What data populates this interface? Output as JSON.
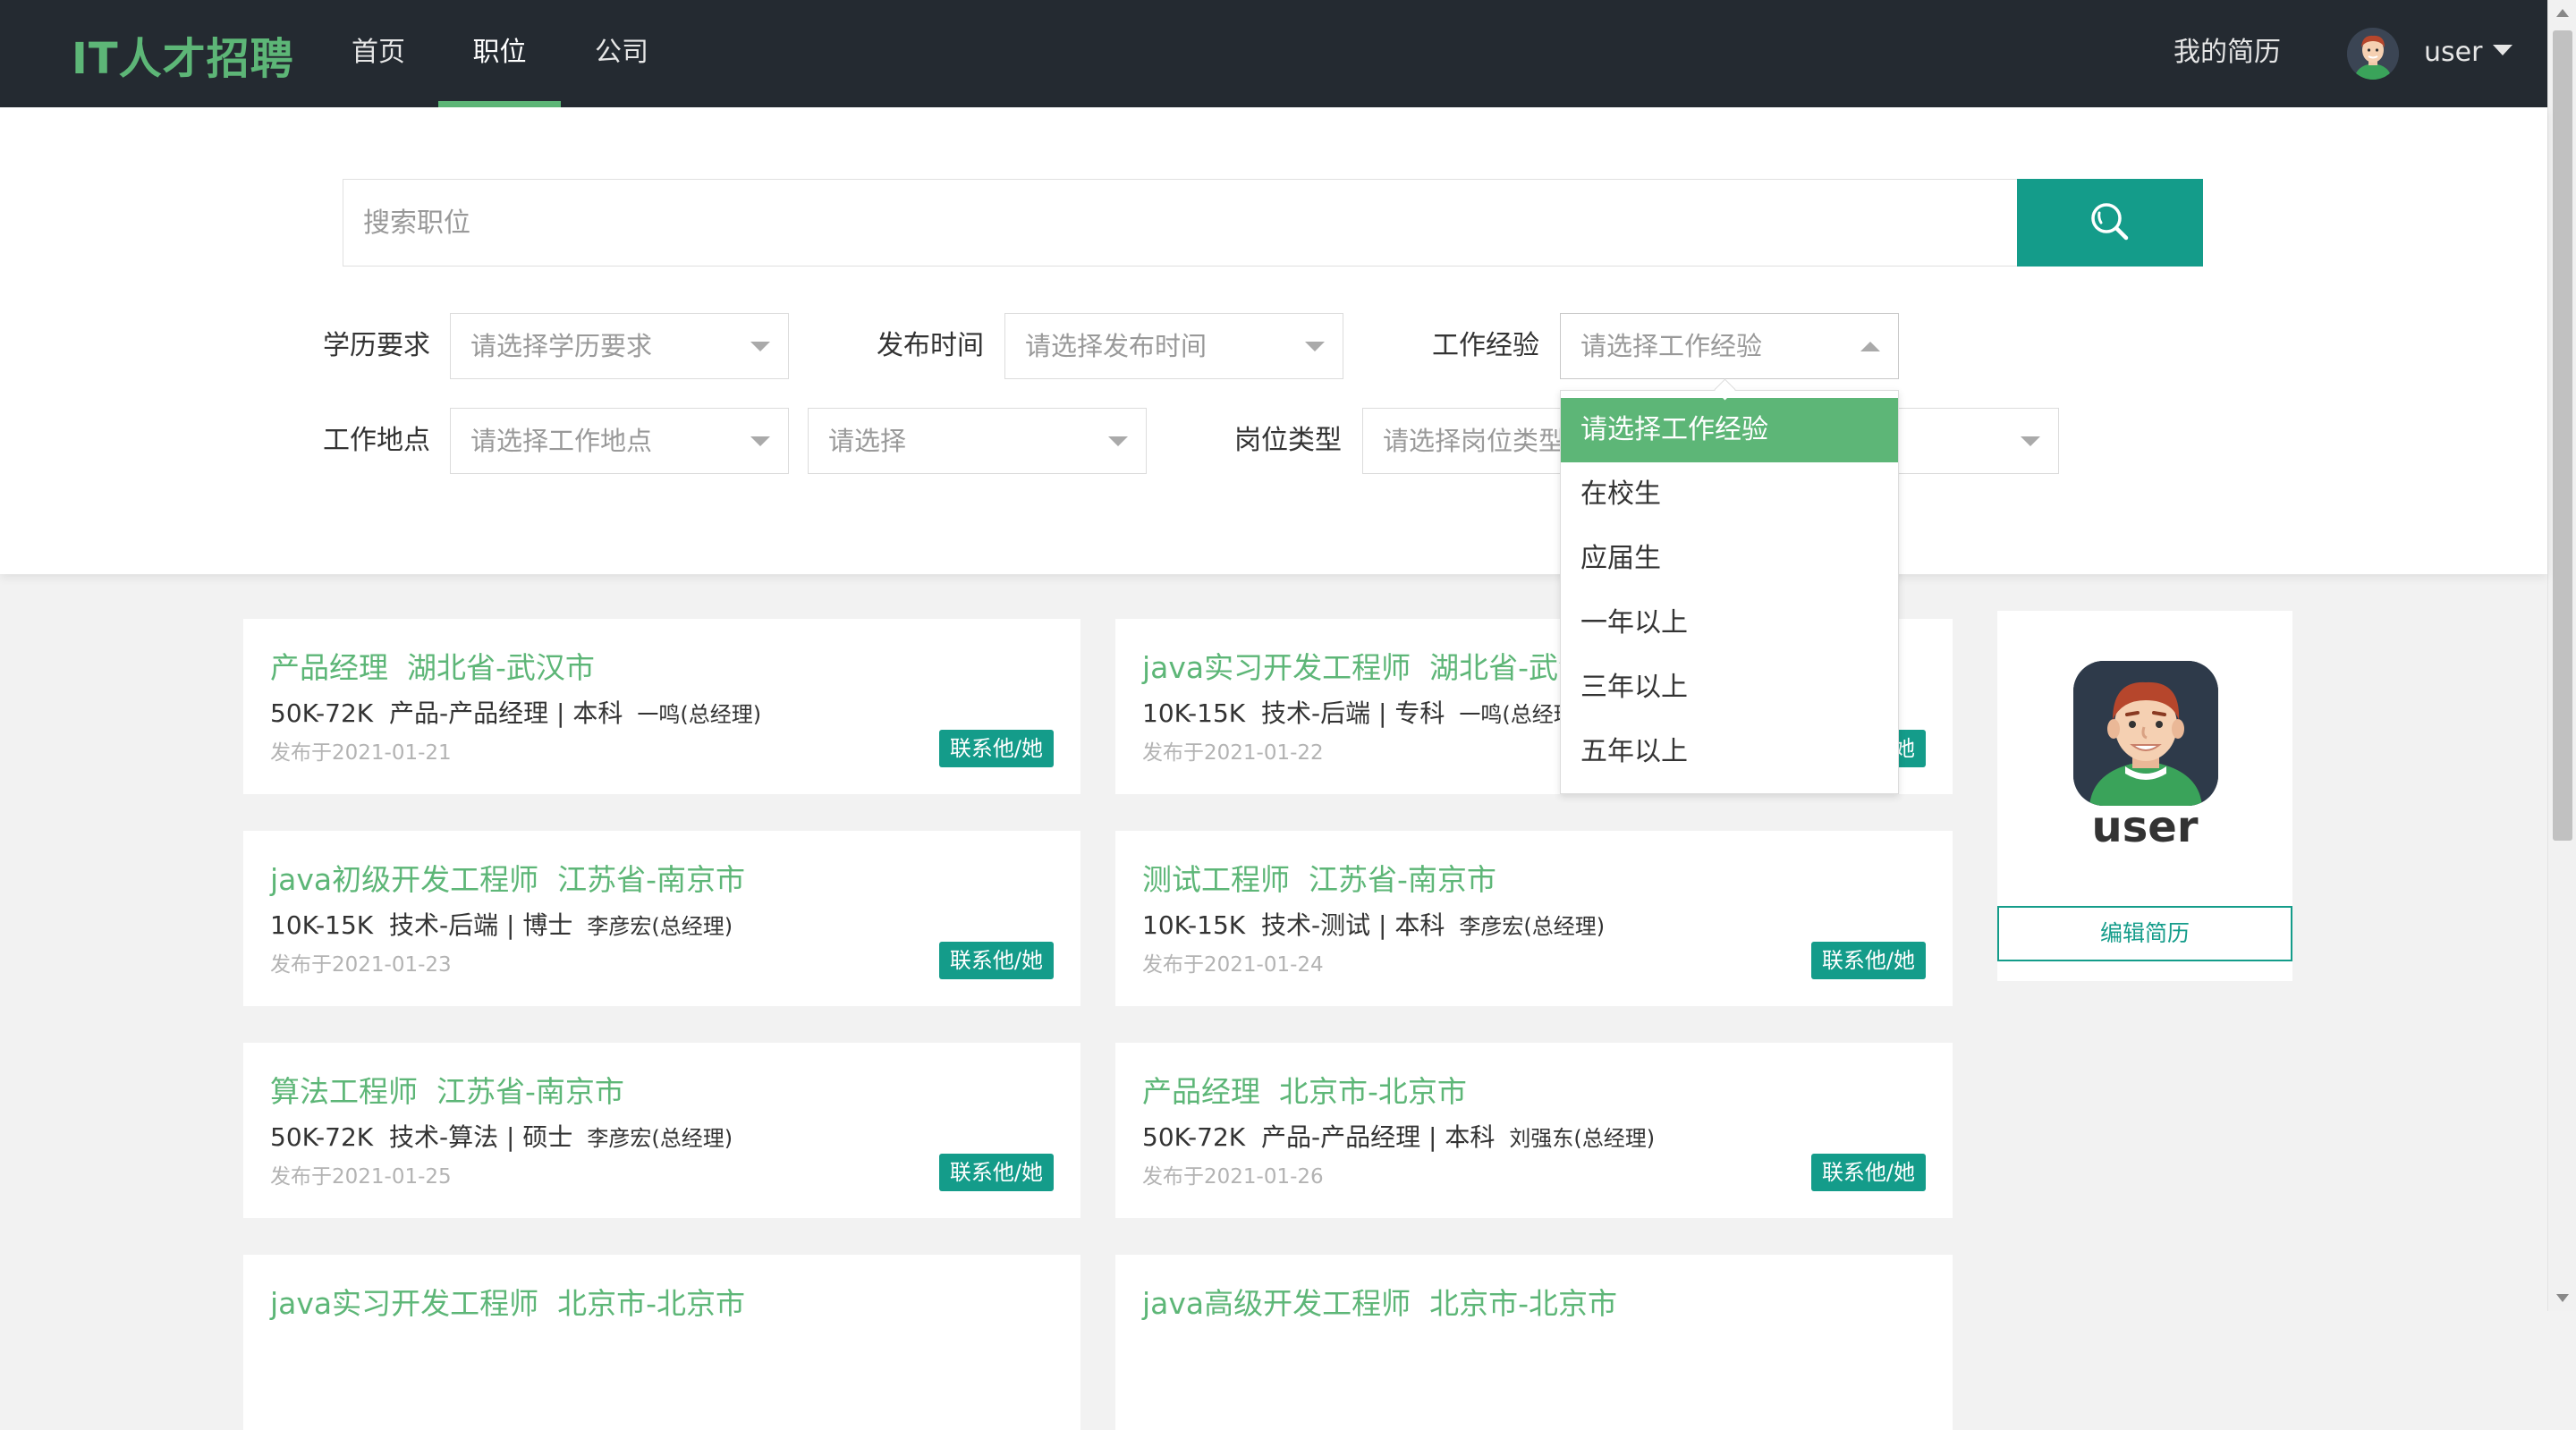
{
  "header": {
    "logo": "IT人才招聘",
    "nav": [
      {
        "label": "首页"
      },
      {
        "label": "职位"
      },
      {
        "label": "公司"
      }
    ],
    "active_nav": "职位",
    "resume_link": "我的简历",
    "username": "user"
  },
  "search": {
    "placeholder": "搜索职位",
    "value": ""
  },
  "filters": {
    "education": {
      "label": "学历要求",
      "placeholder": "请选择学历要求"
    },
    "publish_time": {
      "label": "发布时间",
      "placeholder": "请选择发布时间"
    },
    "experience": {
      "label": "工作经验",
      "placeholder": "请选择工作经验"
    },
    "location": {
      "label": "工作地点",
      "placeholder": "请选择工作地点"
    },
    "city": {
      "placeholder": "请选择"
    },
    "job_type": {
      "label": "岗位类型",
      "placeholder": "请选择岗位类型"
    }
  },
  "experience_dropdown": {
    "options": [
      "请选择工作经验",
      "在校生",
      "应届生",
      "一年以上",
      "三年以上",
      "五年以上"
    ],
    "selected": "请选择工作经验"
  },
  "jobs": [
    {
      "title": "产品经理",
      "location": "湖北省-武汉市",
      "salary": "50K-72K",
      "category": "产品-产品经理",
      "degree": "本科",
      "contact": "一鸣(总经理)",
      "date": "发布于2021-01-21",
      "button": "联系他/她"
    },
    {
      "title": "java实习开发工程师",
      "location": "湖北省-武汉市",
      "salary": "10K-15K",
      "category": "技术-后端",
      "degree": "专科",
      "contact": "一鸣(总经理)",
      "date": "发布于2021-01-22",
      "button": "联系他/她"
    },
    {
      "title": "java初级开发工程师",
      "location": "江苏省-南京市",
      "salary": "10K-15K",
      "category": "技术-后端",
      "degree": "博士",
      "contact": "李彦宏(总经理)",
      "date": "发布于2021-01-23",
      "button": "联系他/她"
    },
    {
      "title": "测试工程师",
      "location": "江苏省-南京市",
      "salary": "10K-15K",
      "category": "技术-测试",
      "degree": "本科",
      "contact": "李彦宏(总经理)",
      "date": "发布于2021-01-24",
      "button": "联系他/她"
    },
    {
      "title": "算法工程师",
      "location": "江苏省-南京市",
      "salary": "50K-72K",
      "category": "技术-算法",
      "degree": "硕士",
      "contact": "李彦宏(总经理)",
      "date": "发布于2021-01-25",
      "button": "联系他/她"
    },
    {
      "title": "产品经理",
      "location": "北京市-北京市",
      "salary": "50K-72K",
      "category": "产品-产品经理",
      "degree": "本科",
      "contact": "刘强东(总经理)",
      "date": "发布于2021-01-26",
      "button": "联系他/她"
    },
    {
      "title": "java实习开发工程师",
      "location": "北京市-北京市"
    },
    {
      "title": "java高级开发工程师",
      "location": "北京市-北京市"
    }
  ],
  "profile": {
    "name": "user",
    "edit_button": "编辑简历"
  },
  "colors": {
    "brand_green": "#5db677",
    "teal": "#149c8a",
    "header_bg": "#242a31"
  }
}
